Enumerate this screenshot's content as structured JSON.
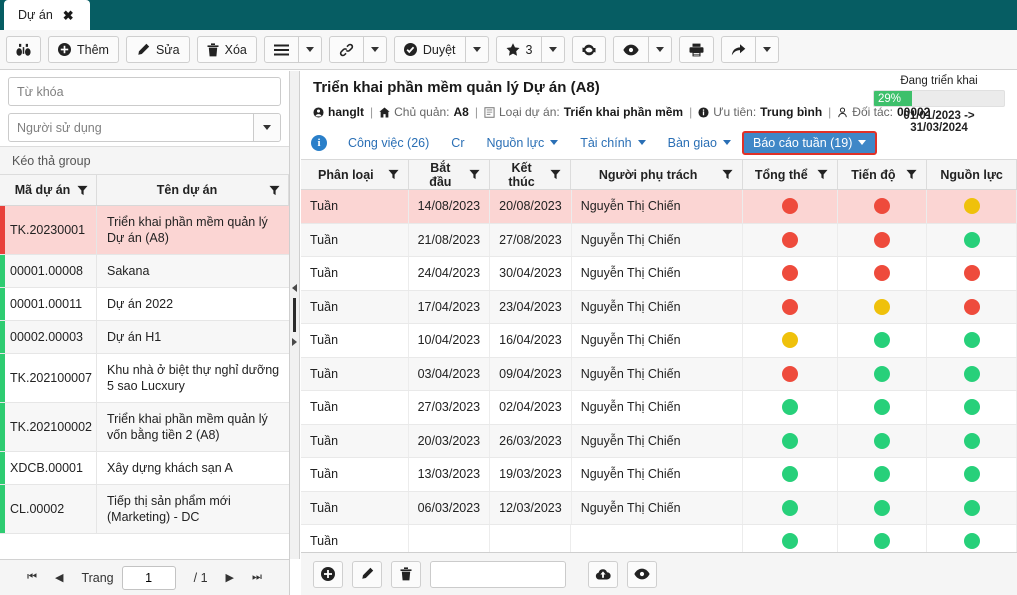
{
  "window": {
    "tab_label": "Dự án",
    "close_icon": "close-icon",
    "header_color": "#065d63"
  },
  "toolbar": {
    "buttons": [
      {
        "name": "search-button",
        "icon": "binoculars-icon",
        "label": ""
      },
      {
        "name": "add-button",
        "icon": "plus-circle-icon",
        "label": "Thêm"
      },
      {
        "name": "edit-button",
        "icon": "pencil-icon",
        "label": "Sửa"
      },
      {
        "name": "delete-button",
        "icon": "trash-icon",
        "label": "Xóa"
      },
      {
        "name": "menu-button",
        "icon": "hamburger-icon",
        "label": "",
        "has_caret": true
      },
      {
        "name": "link-button",
        "icon": "link-icon",
        "label": "",
        "has_caret": true
      },
      {
        "name": "approve-button",
        "icon": "check-circle-icon",
        "label": "Duyệt",
        "has_caret": true
      },
      {
        "name": "favorite-button",
        "icon": "star-icon",
        "label": "3",
        "has_caret": true
      },
      {
        "name": "refresh-button",
        "icon": "refresh-icon",
        "label": ""
      },
      {
        "name": "view-button",
        "icon": "eye-icon",
        "label": "",
        "has_caret": true
      },
      {
        "name": "print-button",
        "icon": "printer-icon",
        "label": ""
      },
      {
        "name": "share-button",
        "icon": "share-arrow-icon",
        "label": "",
        "has_caret": true
      }
    ]
  },
  "sidebar": {
    "keyword_placeholder": "Từ khóa",
    "keyword_value": "",
    "user_select_value": "Người sử dụng",
    "group_bar_label": "Kéo thả group",
    "columns": [
      {
        "label": "Mã dự án",
        "filter_icon": "filter-icon"
      },
      {
        "label": "Tên dự án",
        "filter_icon": "filter-icon"
      }
    ],
    "rows": [
      {
        "code": "TK.20230001",
        "name": "Triển khai phần mềm quản lý Dự án (A8)",
        "stripe": "#e8403a",
        "selected": true
      },
      {
        "code": "00001.00008",
        "name": "Sakana",
        "stripe": "#2ecc71",
        "selected": false
      },
      {
        "code": "00001.00011",
        "name": "Dự án 2022",
        "stripe": "#2ecc71",
        "selected": false
      },
      {
        "code": "00002.00003",
        "name": "Dự án H1",
        "stripe": "#2ecc71",
        "selected": false
      },
      {
        "code": "TK.202100007",
        "name": "Khu nhà ở biệt thự nghỉ dưỡng 5 sao Lucxury",
        "stripe": "#2ecc71",
        "selected": false
      },
      {
        "code": "TK.202100002",
        "name": "Triển khai phần mềm quản lý vốn bằng tiền 2 (A8)",
        "stripe": "#2ecc71",
        "selected": false
      },
      {
        "code": "XDCB.00001",
        "name": "Xây dựng khách sạn A",
        "stripe": "#2ecc71",
        "selected": false
      },
      {
        "code": "CL.00002",
        "name": "Tiếp thị sản phẩm mới (Marketing) - DC",
        "stripe": "#2ecc71",
        "selected": false
      }
    ],
    "pager": {
      "first_icon": "first-page-icon",
      "prev_icon": "prev-page-icon",
      "page_label": "Trang",
      "page_value": "1",
      "total_label": "/ 1",
      "next_icon": "next-page-icon",
      "last_icon": "last-page-icon"
    }
  },
  "project": {
    "title": "Triển khai phần mềm quản lý Dự án (A8)",
    "owner_icon": "user-circle-icon",
    "owner": "hanglt",
    "manager_icon": "home-icon",
    "manager_label": "Chủ quản:",
    "manager_value": "A8",
    "type_icon": "document-icon",
    "type_label": "Loại dự án:",
    "type_value": "Triển khai phần mềm",
    "priority_icon": "info-circle-icon",
    "priority_label": "Ưu tiên:",
    "priority_value": "Trung bình",
    "partner_icon": "person-icon",
    "partner_label": "Đối tác:",
    "partner_value": "00002",
    "status_label": "Đang triển khai",
    "progress_percent": "29%",
    "progress_value": 29,
    "progress_color": "#3ec06b",
    "date_range": "01/01/2023 -> 31/03/2024"
  },
  "tabs": {
    "info_icon": "info-icon",
    "items": [
      {
        "label": "Công việc (26)",
        "caret": false,
        "active": false,
        "name": "tab-cong-viec"
      },
      {
        "label": "Cr",
        "caret": false,
        "active": false,
        "name": "tab-cr"
      },
      {
        "label": "Nguồn lực",
        "caret": true,
        "active": false,
        "name": "tab-nguon-luc"
      },
      {
        "label": "Tài chính",
        "caret": true,
        "active": false,
        "name": "tab-tai-chinh"
      },
      {
        "label": "Bàn giao",
        "caret": true,
        "active": false,
        "name": "tab-ban-giao"
      },
      {
        "label": "Báo cáo tuần (19)",
        "caret": true,
        "active": true,
        "name": "tab-bao-cao-tuan"
      }
    ]
  },
  "grid": {
    "columns": [
      {
        "label": "Phân loại",
        "filter_icon": "filter-icon",
        "cls": "c-phanloai"
      },
      {
        "label": "Bắt đầu",
        "filter_icon": "filter-icon",
        "cls": "c-batdau"
      },
      {
        "label": "Kết thúc",
        "filter_icon": "filter-icon",
        "cls": "c-ketthuc"
      },
      {
        "label": "Người phụ trách",
        "filter_icon": "filter-icon",
        "cls": "c-nguoipt"
      },
      {
        "label": "Tổng thể",
        "filter_icon": "filter-icon",
        "cls": "c-tongthe"
      },
      {
        "label": "Tiến độ",
        "filter_icon": "filter-icon",
        "cls": "c-tiendo"
      },
      {
        "label": "Nguồn lực",
        "filter_icon": "",
        "cls": "c-nguonluc"
      }
    ],
    "status_colors": {
      "red": "#ee4b3c",
      "yellow": "#efc10b",
      "green": "#27d07a"
    },
    "rows": [
      {
        "type": "Tuần",
        "start": "14/08/2023",
        "end": "20/08/2023",
        "owner": "Nguyễn Thị Chiến",
        "overall": "red",
        "progress": "red",
        "resource": "yellow",
        "selected": true
      },
      {
        "type": "Tuần",
        "start": "21/08/2023",
        "end": "27/08/2023",
        "owner": "Nguyễn Thị Chiến",
        "overall": "red",
        "progress": "red",
        "resource": "green",
        "selected": false
      },
      {
        "type": "Tuần",
        "start": "24/04/2023",
        "end": "30/04/2023",
        "owner": "Nguyễn Thị Chiến",
        "overall": "red",
        "progress": "red",
        "resource": "red",
        "selected": false
      },
      {
        "type": "Tuần",
        "start": "17/04/2023",
        "end": "23/04/2023",
        "owner": "Nguyễn Thị Chiến",
        "overall": "red",
        "progress": "yellow",
        "resource": "red",
        "selected": false
      },
      {
        "type": "Tuần",
        "start": "10/04/2023",
        "end": "16/04/2023",
        "owner": "Nguyễn Thị Chiến",
        "overall": "yellow",
        "progress": "green",
        "resource": "green",
        "selected": false
      },
      {
        "type": "Tuần",
        "start": "03/04/2023",
        "end": "09/04/2023",
        "owner": "Nguyễn Thị Chiến",
        "overall": "red",
        "progress": "green",
        "resource": "green",
        "selected": false
      },
      {
        "type": "Tuần",
        "start": "27/03/2023",
        "end": "02/04/2023",
        "owner": "Nguyễn Thị Chiến",
        "overall": "green",
        "progress": "green",
        "resource": "green",
        "selected": false
      },
      {
        "type": "Tuần",
        "start": "20/03/2023",
        "end": "26/03/2023",
        "owner": "Nguyễn Thị Chiến",
        "overall": "green",
        "progress": "green",
        "resource": "green",
        "selected": false
      },
      {
        "type": "Tuần",
        "start": "13/03/2023",
        "end": "19/03/2023",
        "owner": "Nguyễn Thị Chiến",
        "overall": "green",
        "progress": "green",
        "resource": "green",
        "selected": false
      },
      {
        "type": "Tuần",
        "start": "06/03/2023",
        "end": "12/03/2023",
        "owner": "Nguyễn Thị Chiến",
        "overall": "green",
        "progress": "green",
        "resource": "green",
        "selected": false
      },
      {
        "type": "Tuần",
        "start": "",
        "end": "",
        "owner": "",
        "overall": "green",
        "progress": "green",
        "resource": "green",
        "selected": false
      }
    ]
  },
  "bottombar": {
    "add_icon": "plus-circle-icon",
    "edit_icon": "pencil-icon",
    "delete_icon": "trash-icon",
    "field_value": "",
    "upload_icon": "cloud-upload-icon",
    "view_icon": "eye-icon"
  }
}
